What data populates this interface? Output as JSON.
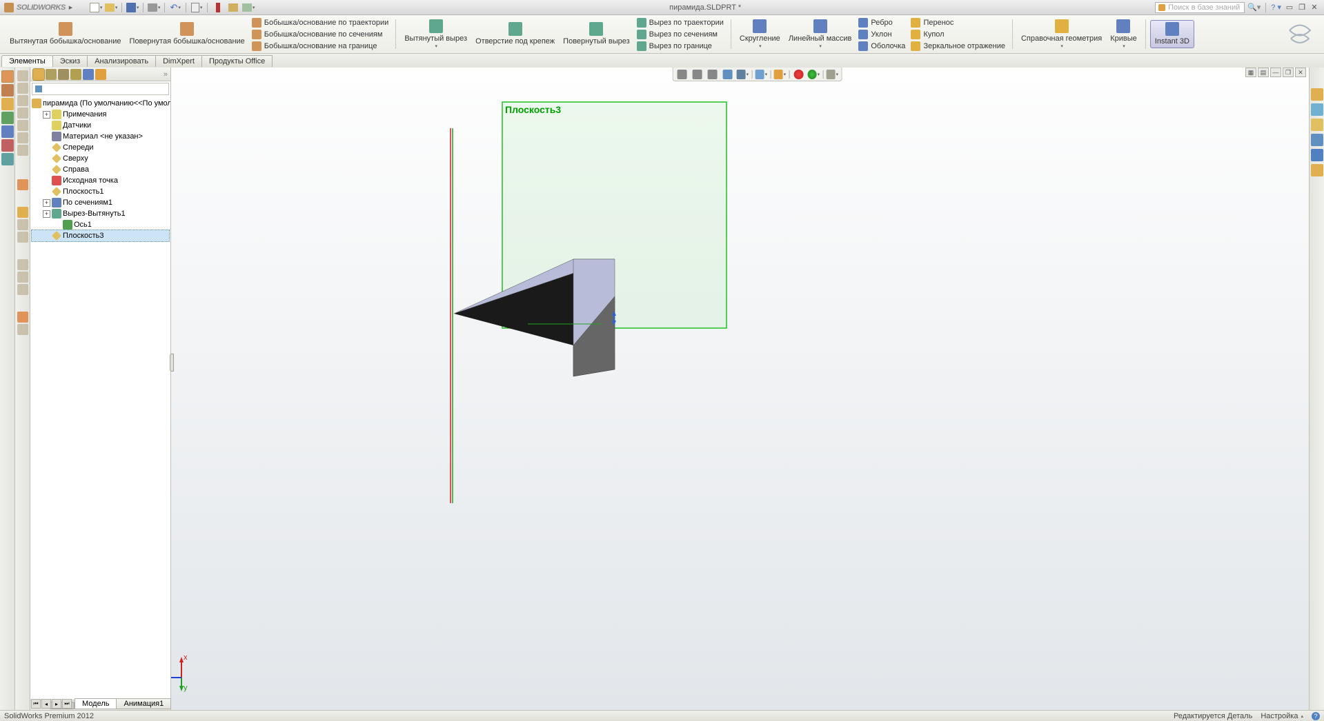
{
  "app": {
    "brand": "SOLIDWORKS",
    "title": "пирамида.SLDPRT *",
    "search_placeholder": "Поиск в базе знаний",
    "version": "SolidWorks Premium 2012"
  },
  "ribbon": {
    "extruded_boss": "Вытянутая бобышка/основание",
    "revolved_boss": "Повернутая бобышка/основание",
    "swept_boss": "Бобышка/основание по траектории",
    "lofted_boss": "Бобышка/основание по сечениям",
    "boundary_boss": "Бобышка/основание на границе",
    "extruded_cut": "Вытянутый вырез",
    "hole_wizard": "Отверстие под крепеж",
    "revolved_cut": "Повернутый вырез",
    "swept_cut": "Вырез по траектории",
    "lofted_cut": "Вырез по сечениям",
    "boundary_cut": "Вырез по границе",
    "fillet": "Скругление",
    "linear_pattern": "Линейный массив",
    "rib": "Ребро",
    "draft": "Уклон",
    "shell": "Оболочка",
    "wrap": "Перенос",
    "dome": "Купол",
    "mirror": "Зеркальное отражение",
    "ref_geom": "Справочная геометрия",
    "curves": "Кривые",
    "instant3d": "Instant 3D"
  },
  "tabs": {
    "features": "Элементы",
    "sketch": "Эскиз",
    "analyze": "Анализировать",
    "dimxpert": "DimXpert",
    "office": "Продукты Office"
  },
  "tree": {
    "root": "пирамида  (По умолчанию<<По умол",
    "annotations": "Примечания",
    "sensors": "Датчики",
    "material": "Материал <не указан>",
    "front": "Спереди",
    "top": "Сверху",
    "right": "Справа",
    "origin": "Исходная точка",
    "plane1": "Плоскость1",
    "loft1": "По сечениям1",
    "cut_extrude1": "Вырез-Вытянуть1",
    "axis1": "Ось1",
    "plane3": "Плоскость3"
  },
  "viewport": {
    "plane_label": "Плоскость3"
  },
  "bottom_tabs": {
    "model": "Модель",
    "anim1": "Анимация1"
  },
  "status": {
    "editing": "Редактируется Деталь",
    "settings": "Настройка"
  }
}
